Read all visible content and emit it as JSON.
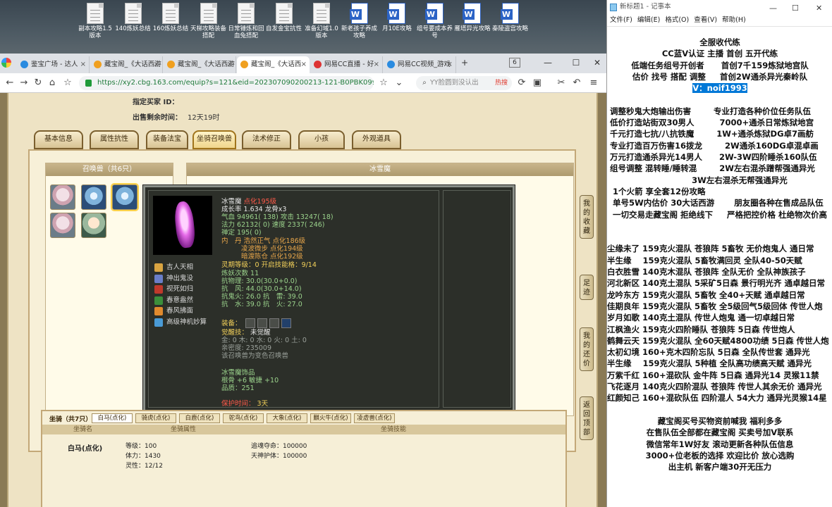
{
  "desktop_icons": [
    {
      "label": "副本攻略1.5版本",
      "type": "txt"
    },
    {
      "label": "140炼妖总结",
      "type": "txt"
    },
    {
      "label": "160炼妖总结",
      "type": "txt"
    },
    {
      "label": "天梯攻略装备搭配",
      "type": "txt"
    },
    {
      "label": "日常锤炼和回血兔搭配",
      "type": "txt"
    },
    {
      "label": "自发金宝抗性",
      "type": "txt"
    },
    {
      "label": "准备幻域1.0版本",
      "type": "txt"
    },
    {
      "label": "新老孩子养成攻略",
      "type": "doc"
    },
    {
      "label": "月10E攻略",
      "type": "doc"
    },
    {
      "label": "组号要成本养号",
      "type": "doc"
    },
    {
      "label": "雁塔异光攻略",
      "type": "doc"
    },
    {
      "label": "秦陵盗宫攻略",
      "type": "doc"
    }
  ],
  "browser": {
    "tabs": [
      {
        "label": "鉴宝广场 - 达人",
        "active": false
      },
      {
        "label": "藏宝阁_《大话西游",
        "active": false
      },
      {
        "label": "藏宝阁_《大话西游",
        "active": false
      },
      {
        "label": "藏宝阁_《大话西",
        "active": true
      },
      {
        "label": "网易CC直播 - 好",
        "active": false
      },
      {
        "label": "网易CC视频_游戏",
        "active": false
      }
    ],
    "tab_count": "6",
    "url": "https://xy2.cbg.163.com/equip?s=121&eid=202307090200213-121-B0PBK0999GJ3",
    "search_placeholder": "YY脸圆到没认出",
    "search_hot": "热搜"
  },
  "listing": {
    "buyer_label": "指定买家 ID：",
    "time_label": "出售剩余时间：",
    "time_value": "12天19时"
  },
  "game_tabs": [
    "基本信息",
    "属性抗性",
    "装备法宝",
    "坐骑召唤兽",
    "法术修正",
    "小孩",
    "外观道具"
  ],
  "active_tab_index": 3,
  "pets_box_title": "召唤兽（共6只）",
  "detail_box_title": "冰雪魔",
  "tooltip": {
    "name": "冰雪魔",
    "tag": "点化195级",
    "growth": "成长率 1.634 龙骨x3",
    "hp": "气血 94961( 138) 攻击 13247( 18)",
    "mp": "法力 62132( 0) 速度 2337( 246)",
    "zen": "禅定 195( 0)",
    "dan1": "内　丹 浩然正气 点化186级",
    "dan2": "凌波微步 点化194级",
    "dan3": "暗渡陈仓 点化192级",
    "spirit": "灵期等级：0 开启技能格：9/14",
    "lianyao": "炼妖次数 11",
    "res1": "抗物理: 30.0(30.0+0.0)",
    "res2": "抗　风: 44.0(30.0+14.0)",
    "res3": "抗鬼火: 26.0 抗　雷: 39.0",
    "res4": "抗　水: 39.0 抗　火: 27.0",
    "equip_label": "装备：",
    "awaken": "觉醒技：",
    "awaken_value": "未觉醒",
    "elements": "金: 0 木: 0 水: 0 火: 0 土: 0",
    "intimacy": "亲密度: 235009",
    "variant": "该召唤兽为变色召唤兽",
    "ornament_title": "冰雪魔饰品",
    "ornament1": "根骨 +6 敏捷 +10",
    "ornament2": "品质：251",
    "protect_label": "保护时间：",
    "protect_value": "3天",
    "skills": [
      {
        "label": "吉人天相",
        "color": "#d9a441"
      },
      {
        "label": "神出鬼没",
        "color": "#6a7ec8"
      },
      {
        "label": "视死如归",
        "color": "#c0392b"
      },
      {
        "label": "春意盎然",
        "color": "#3b8f3b"
      },
      {
        "label": "春风拂面",
        "color": "#e08a2e"
      },
      {
        "label": "高级神机妙算",
        "color": "#4a9bd6"
      }
    ]
  },
  "side_buttons": [
    "我的收藏",
    "足迹",
    "我的还价",
    "返回顶部"
  ],
  "mount": {
    "title": "坐骑（共7只）",
    "tabs": [
      "白马(点化)",
      "骑虎(点化)",
      "白鹿(点化)",
      "驼鸟(点化)",
      "大象(点化)",
      "麒火牛(点化)",
      "凌虚兽(点化)"
    ],
    "header": [
      "坐骑名",
      "坐骑属性",
      "坐骑技能"
    ],
    "name": "白马(点化)",
    "grade": "等级：100",
    "stamina": "体力：1430",
    "spirit": "灵性：12/12",
    "life": "追魂夺命：100000",
    "guard": "天神护体：100000"
  },
  "notepad": {
    "title": "新标题1 - 记事本",
    "menu": [
      "文件(F)",
      "编辑(E)",
      "格式(O)",
      "查看(V)",
      "帮助(H)"
    ],
    "lines": [
      {
        "t": "全服收代练",
        "c": true
      },
      {
        "t": "CC蓝V认证 主播 首创 五开代练",
        "c": true
      },
      {
        "t": "低端任务组号开创者      首创7千159炼狱地宫队",
        "c": true
      },
      {
        "t": "估价 找号 搭配 调整     首创2W通杀异光秦岭队",
        "c": true
      },
      {
        "t": "V：noif1993",
        "c": true,
        "sel": true
      },
      {
        "t": "",
        "c": false
      },
      {
        "t": " 调整秒鬼大炮输出伤害        专业打造各种价位任务队伍",
        "c": false
      },
      {
        "t": " 低价打造站街双30男人         7000+通杀日常炼狱地宫",
        "c": false
      },
      {
        "t": " 千元打造七抗/八抗铁魔        1W+通杀炼狱DG卓7画舫",
        "c": false
      },
      {
        "t": " 专业打造百万伤害16拨龙        2W通杀160DG卓混卓画",
        "c": false
      },
      {
        "t": " 万元打造通杀异光14男人      2W-3W四阶睡杀160队伍",
        "c": false
      },
      {
        "t": " 组号调整 混转睡/睡转混        2W左右混杀蹭帮强通异光",
        "c": false
      },
      {
        "t": "                              3W左右混杀无帮强通异光",
        "c": false
      },
      {
        "t": "  1个火箭 享全套12份攻略",
        "c": false
      },
      {
        "t": "  单号5W内估价 30大话西游       朋友圈各种在售成品队伍",
        "c": false
      },
      {
        "t": "  一切交易走藏宝阁 拒绝线下     严格把控价格 杜绝物次价高",
        "c": false
      },
      {
        "t": "",
        "c": false
      },
      {
        "t": "",
        "c": false
      },
      {
        "t": "尘缘未了 159克火混队 苍狼阵 5畜牧 无价炮鬼人 通日常",
        "c": false
      },
      {
        "t": "半生缘    159克火混队 5畜牧满回灵 全队40-50天赋",
        "c": false
      },
      {
        "t": "白衣胜雪 140克木混队 苍狼阵 全队无价 全队神族孩子",
        "c": false
      },
      {
        "t": "河北新区 140克土混队 5采矿5日森 景行明光齐 通卓越日常",
        "c": false
      },
      {
        "t": "龙吟东方 159克火混队 5畜牧 全40+天赋 通卓越日常",
        "c": false
      },
      {
        "t": "佳期良年 159克火混队 5畜牧 全5级回气5级回体 传世人炮",
        "c": false
      },
      {
        "t": "岁月如歌 140克土混队 传世人炮鬼 通一切卓越日常",
        "c": false
      },
      {
        "t": "江枫渔火 159克火四阶睡队 苍狼阵 5日森 传世炮人",
        "c": false
      },
      {
        "t": "鹤舞云天 159克火混队 全60天赋4800功绩 5日森 传世人炮",
        "c": false
      },
      {
        "t": "太初幻境 160+克木四阶忘队 5日森 全队传世套 通异光",
        "c": false
      },
      {
        "t": "半生缘    159克火混队 5种植 全队高功绩高天赋 通异光",
        "c": false
      },
      {
        "t": "万紫千红 160+混砍队 金牛阵 5日森 通异光14 灵猴11禁",
        "c": false
      },
      {
        "t": "飞花逐月 140克火四阶混队 苍狼阵 传世人其余无价 通异光",
        "c": false
      },
      {
        "t": "红颜知己 160+混砍队伍 四阶混人 54大力 通异光灵猴14星",
        "c": false
      },
      {
        "t": "",
        "c": false
      },
      {
        "t": "藏宝阁买号买物资前喊我 福利多多",
        "c": true
      },
      {
        "t": "在售队伍全部都在藏宝阁 买卖号加V联系",
        "c": true
      },
      {
        "t": "微信常年1W好友 滚动更新各种队伍信息",
        "c": true
      },
      {
        "t": "3000+位老板的选择 欢迎比价 放心选购",
        "c": true
      },
      {
        "t": "出主机 新客户端30开无压力",
        "c": true
      }
    ]
  }
}
